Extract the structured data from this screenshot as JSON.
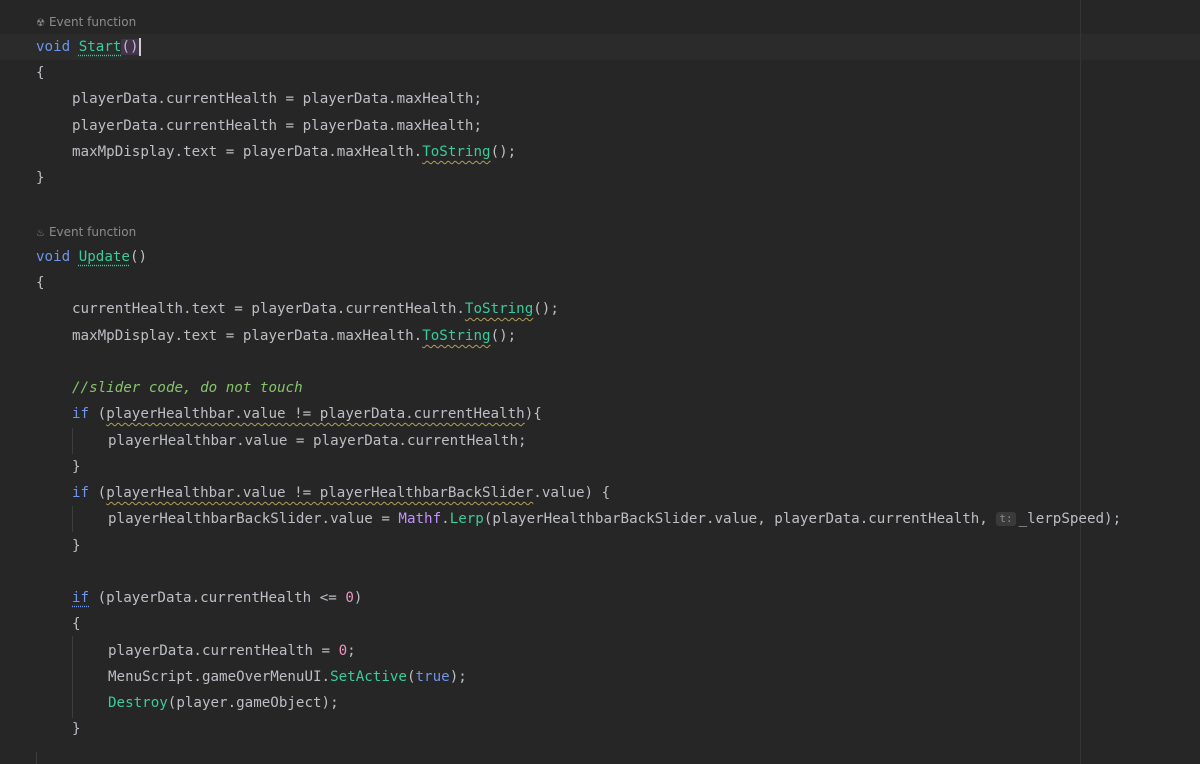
{
  "editor": {
    "hints": {
      "start": "Event function",
      "update": "Event function"
    },
    "code": {
      "l_void1": "void",
      "l_start": "Start",
      "l_start_parens": "()",
      "brace_open1": "{",
      "s1": "playerData.currentHealth = playerData.maxHealth;",
      "s2": "playerData.currentHealth = playerData.maxHealth;",
      "s3_a": "maxMpDisplay.text = playerData.maxHealth.",
      "s3_b": "ToString",
      "s3_c": "();",
      "brace_close1": "}",
      "l_void2": "void",
      "l_update": "Update",
      "l_update_parens": "()",
      "brace_open2": "{",
      "u1_a": "currentHealth.text = playerData.currentHealth.",
      "u1_b": "ToString",
      "u1_c": "();",
      "u2_a": "maxMpDisplay.text = playerData.maxHealth.",
      "u2_b": "ToString",
      "u2_c": "();",
      "comment": "//slider code, do not touch",
      "if1_kw": "if",
      "if1_open": " (",
      "if1_cond": "playerHealthbar.value != playerData.currentHealth",
      "if1_close": "){",
      "if1_body": "playerHealthbar.value = playerData.currentHealth;",
      "if1_end": "}",
      "if2_kw": "if",
      "if2_open": " (",
      "if2_cond": "playerHealthbar.value != playerHealthbarBackSlider",
      "if2_close": ".value) {",
      "if2_body_a": "playerHealthbarBackSlider.value = ",
      "if2_body_type": "Mathf",
      "if2_body_dot": ".",
      "if2_body_fn": "Lerp",
      "if2_body_b": "(playerHealthbarBackSlider.value, playerData.currentHealth, ",
      "if2_inlay": "t:",
      "if2_body_c": "_lerpSpeed);",
      "if2_end": "}",
      "if3_kw": "if",
      "if3_a": " (playerData.currentHealth <= ",
      "if3_num": "0",
      "if3_b": ")",
      "if3_brace": "{",
      "b1_a": "playerData.currentHealth = ",
      "b1_num": "0",
      "b1_b": ";",
      "b2_a": "MenuScript.gameOverMenuUI.",
      "b2_fn": "SetActive",
      "b2_b": "(",
      "b2_kw": "true",
      "b2_c": ");",
      "b3_fn": "Destroy",
      "b3_a": "(player.gameObject);",
      "if3_end": "}"
    }
  },
  "colors": {
    "background": "#262626",
    "keyword": "#6c95eb",
    "method": "#39cc9b",
    "type": "#c191ff",
    "number": "#ed94c0",
    "comment": "#85c46c"
  }
}
